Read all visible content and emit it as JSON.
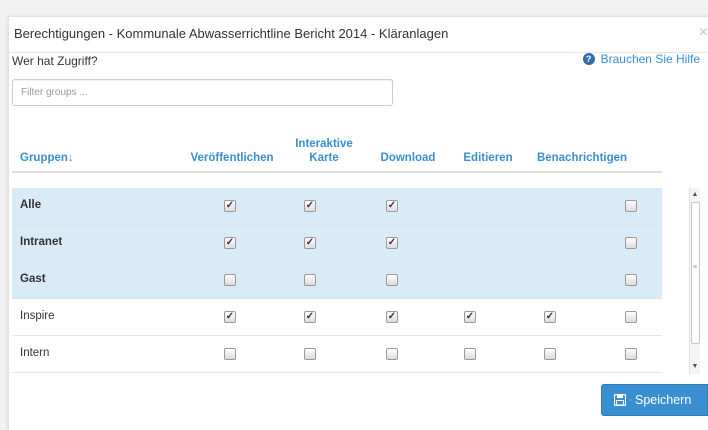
{
  "modal": {
    "title": "Berechtigungen - Kommunale Abwasserrichtline Bericht 2014 - Kläranlagen",
    "close_label": "×"
  },
  "access": {
    "label": "Wer hat Zugriff?",
    "help_label": "Brauchen Sie Hilfe",
    "help_icon": "?"
  },
  "filter": {
    "placeholder": "Filter groups ...",
    "value": ""
  },
  "table": {
    "headers": {
      "group": "Gruppen",
      "sort_icon": "↓",
      "publish": "Veröffentlichen",
      "map": "Interaktive Karte",
      "download": "Download",
      "edit": "Editieren",
      "notify": "Benachrichtigen"
    },
    "rows": [
      {
        "name": "Alle",
        "bold": true,
        "highlight": true,
        "publish": true,
        "map": true,
        "download": true,
        "edit": null,
        "notify": null,
        "extra": false
      },
      {
        "name": "Intranet",
        "bold": true,
        "highlight": true,
        "publish": true,
        "map": true,
        "download": true,
        "edit": null,
        "notify": null,
        "extra": false
      },
      {
        "name": "Gast",
        "bold": true,
        "highlight": true,
        "publish": false,
        "map": false,
        "download": false,
        "edit": null,
        "notify": null,
        "extra": false
      },
      {
        "name": "Inspire",
        "bold": false,
        "highlight": false,
        "publish": true,
        "map": true,
        "download": true,
        "edit": true,
        "notify": true,
        "extra": false
      },
      {
        "name": "Intern",
        "bold": false,
        "highlight": false,
        "publish": false,
        "map": false,
        "download": false,
        "edit": false,
        "notify": false,
        "extra": false
      }
    ]
  },
  "footer": {
    "save_label": "Speichern"
  },
  "colors": {
    "accent": "#3a8fd0",
    "row_highlight": "#d9ebf6"
  }
}
